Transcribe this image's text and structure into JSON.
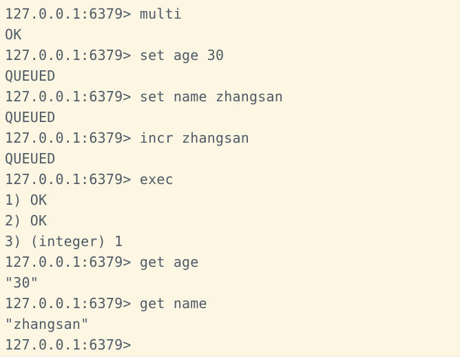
{
  "terminal": {
    "lines": [
      "127.0.0.1:6379> multi",
      "OK",
      "127.0.0.1:6379> set age 30",
      "QUEUED",
      "127.0.0.1:6379> set name zhangsan",
      "QUEUED",
      "127.0.0.1:6379> incr zhangsan",
      "QUEUED",
      "127.0.0.1:6379> exec",
      "1) OK",
      "2) OK",
      "3) (integer) 1",
      "127.0.0.1:6379> get age",
      "\"30\"",
      "127.0.0.1:6379> get name",
      "\"zhangsan\"",
      "127.0.0.1:6379>"
    ]
  },
  "colors": {
    "background": "#FDF6E3",
    "text": "#4E5B66"
  }
}
